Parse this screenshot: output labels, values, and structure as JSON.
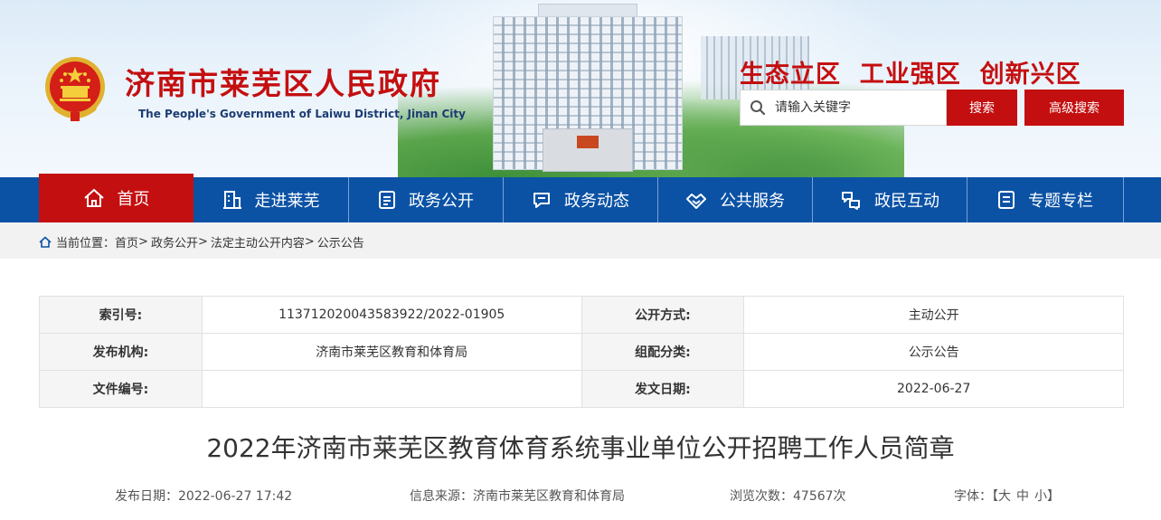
{
  "header": {
    "title": "济南市莱芜区人民政府",
    "subtitle": "The People's Government of Laiwu District, Jinan City",
    "slogan": "生态立区  工业强区  创新兴区",
    "search_placeholder": "请输入关键字",
    "search_button": "搜索",
    "advanced_search_button": "高级搜索",
    "colors": {
      "brand_red": "#c40f10",
      "nav_blue": "#0b52a5"
    }
  },
  "nav": {
    "items": [
      {
        "label": "首页",
        "icon": "home-icon",
        "active": true
      },
      {
        "label": "走进莱芜",
        "icon": "building-icon"
      },
      {
        "label": "政务公开",
        "icon": "document-icon"
      },
      {
        "label": "政务动态",
        "icon": "news-icon"
      },
      {
        "label": "公共服务",
        "icon": "handshake-icon"
      },
      {
        "label": "政民互动",
        "icon": "interaction-icon"
      },
      {
        "label": "专题专栏",
        "icon": "column-icon"
      }
    ]
  },
  "breadcrumb": {
    "prefix": "当前位置：",
    "items": [
      "首页",
      "政务公开",
      "法定主动公开内容",
      "公示公告"
    ],
    "separator": ">"
  },
  "info_table": {
    "rows": [
      [
        {
          "label": "索引号:",
          "value": "113712020043583922/2022-01905"
        },
        {
          "label": "公开方式:",
          "value": "主动公开"
        }
      ],
      [
        {
          "label": "发布机构:",
          "value": "济南市莱芜区教育和体育局"
        },
        {
          "label": "组配分类:",
          "value": "公示公告"
        }
      ],
      [
        {
          "label": "文件编号:",
          "value": ""
        },
        {
          "label": "发文日期:",
          "value": "2022-06-27"
        }
      ]
    ]
  },
  "document": {
    "title": "2022年济南市莱芜区教育体育系统事业单位公开招聘工作人员简章",
    "publish_date": "发布日期：2022-06-27 17:42",
    "source": "信息来源：济南市莱芜区教育和体育局",
    "views": "浏览次数：47567次",
    "font_size_label": "字体：【",
    "font_sizes": [
      "大",
      "中",
      "小"
    ],
    "font_size_close": "】"
  }
}
